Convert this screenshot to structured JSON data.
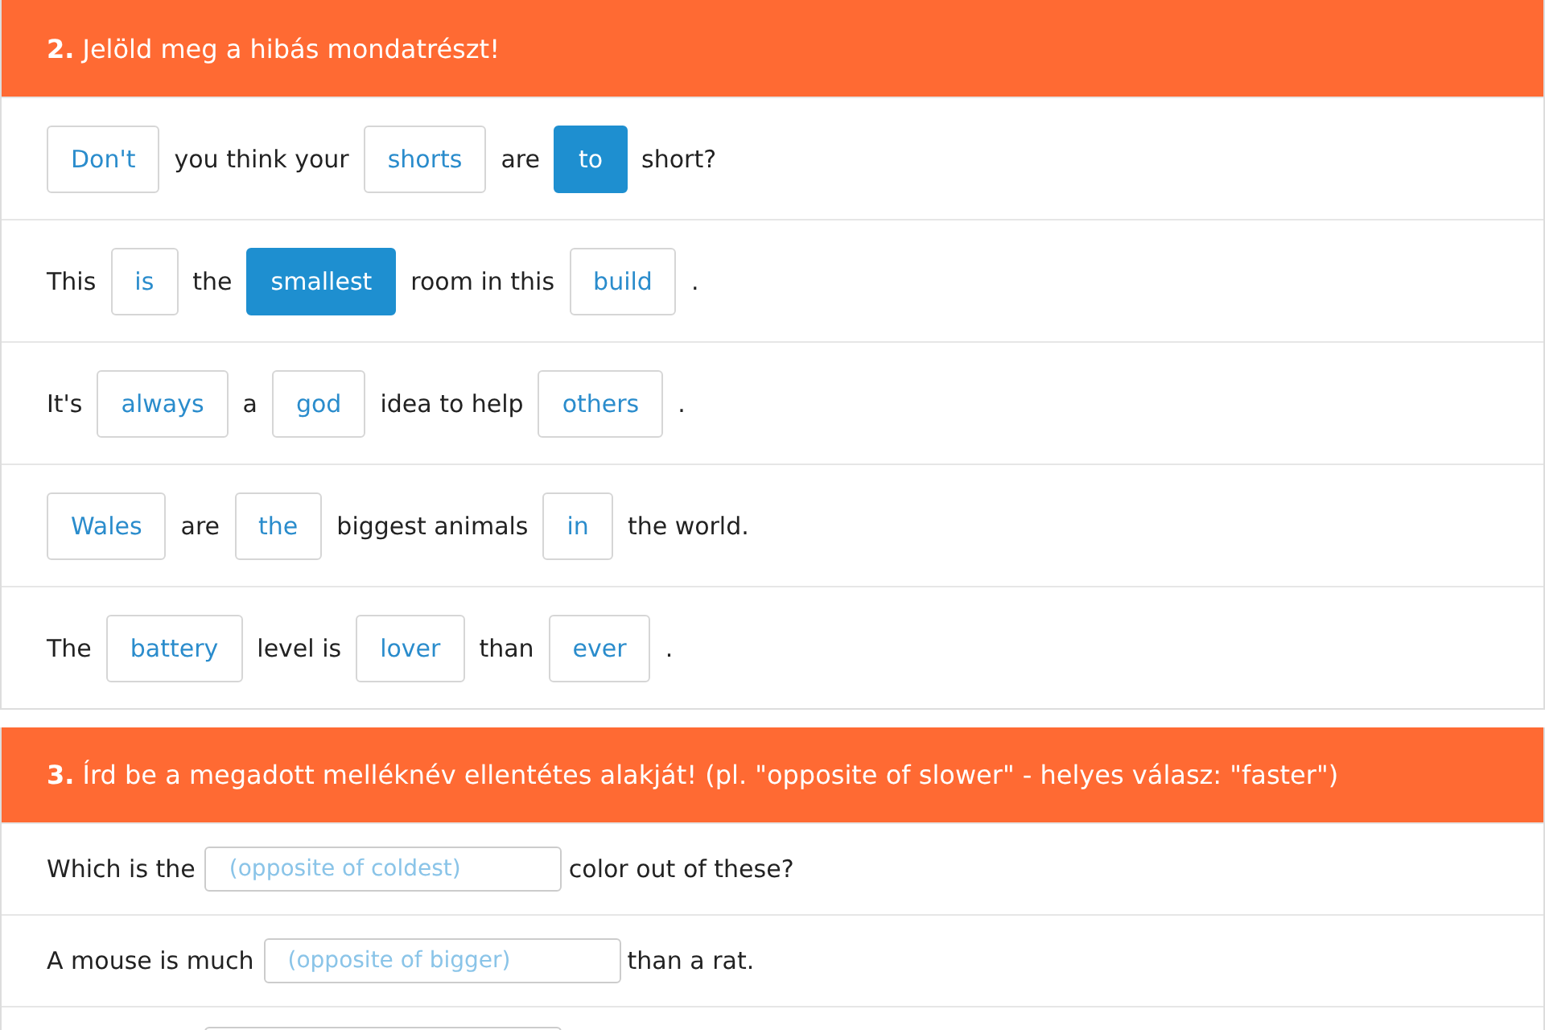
{
  "sections": [
    {
      "number": "2.",
      "title": "Jelöld meg a hibás mondatrészt!",
      "kind": "choices",
      "rows": [
        {
          "items": [
            {
              "kind": "choice",
              "text": "Don't",
              "selected": false
            },
            {
              "kind": "text",
              "text": "you think your"
            },
            {
              "kind": "choice",
              "text": "shorts",
              "selected": false
            },
            {
              "kind": "text",
              "text": "are"
            },
            {
              "kind": "choice",
              "text": "to",
              "selected": true
            },
            {
              "kind": "text",
              "text": "short?"
            }
          ]
        },
        {
          "items": [
            {
              "kind": "text",
              "text": "This"
            },
            {
              "kind": "choice",
              "text": "is",
              "selected": false
            },
            {
              "kind": "text",
              "text": "the"
            },
            {
              "kind": "choice",
              "text": "smallest",
              "selected": true
            },
            {
              "kind": "text",
              "text": "room in this"
            },
            {
              "kind": "choice",
              "text": "build",
              "selected": false
            },
            {
              "kind": "text",
              "text": "."
            }
          ]
        },
        {
          "items": [
            {
              "kind": "text",
              "text": "It's"
            },
            {
              "kind": "choice",
              "text": "always",
              "selected": false
            },
            {
              "kind": "text",
              "text": "a"
            },
            {
              "kind": "choice",
              "text": "god",
              "selected": false
            },
            {
              "kind": "text",
              "text": "idea to help"
            },
            {
              "kind": "choice",
              "text": "others",
              "selected": false
            },
            {
              "kind": "text",
              "text": "."
            }
          ]
        },
        {
          "items": [
            {
              "kind": "choice",
              "text": "Wales",
              "selected": false
            },
            {
              "kind": "text",
              "text": "are"
            },
            {
              "kind": "choice",
              "text": "the",
              "selected": false
            },
            {
              "kind": "text",
              "text": "biggest animals"
            },
            {
              "kind": "choice",
              "text": "in",
              "selected": false
            },
            {
              "kind": "text",
              "text": "the world."
            }
          ]
        },
        {
          "items": [
            {
              "kind": "text",
              "text": "The"
            },
            {
              "kind": "choice",
              "text": "battery",
              "selected": false
            },
            {
              "kind": "text",
              "text": "level is"
            },
            {
              "kind": "choice",
              "text": "lover",
              "selected": false
            },
            {
              "kind": "text",
              "text": "than"
            },
            {
              "kind": "choice",
              "text": "ever",
              "selected": false
            },
            {
              "kind": "text",
              "text": "."
            }
          ]
        }
      ]
    },
    {
      "number": "3.",
      "title": "Írd be a megadott melléknév ellentétes alakját! (pl. \"opposite of slower\" - helyes válasz: \"faster\")",
      "kind": "fields",
      "rows": [
        {
          "items": [
            {
              "kind": "text",
              "text": "Which is the"
            },
            {
              "kind": "field",
              "placeholder": "(opposite of coldest)"
            },
            {
              "kind": "text",
              "text": "color out of these?"
            }
          ]
        },
        {
          "items": [
            {
              "kind": "text",
              "text": "A mouse is much"
            },
            {
              "kind": "field",
              "placeholder": "(opposite of bigger)"
            },
            {
              "kind": "text",
              "text": "than a rat."
            }
          ]
        },
        {
          "items": [
            {
              "kind": "field"
            }
          ]
        }
      ]
    }
  ]
}
